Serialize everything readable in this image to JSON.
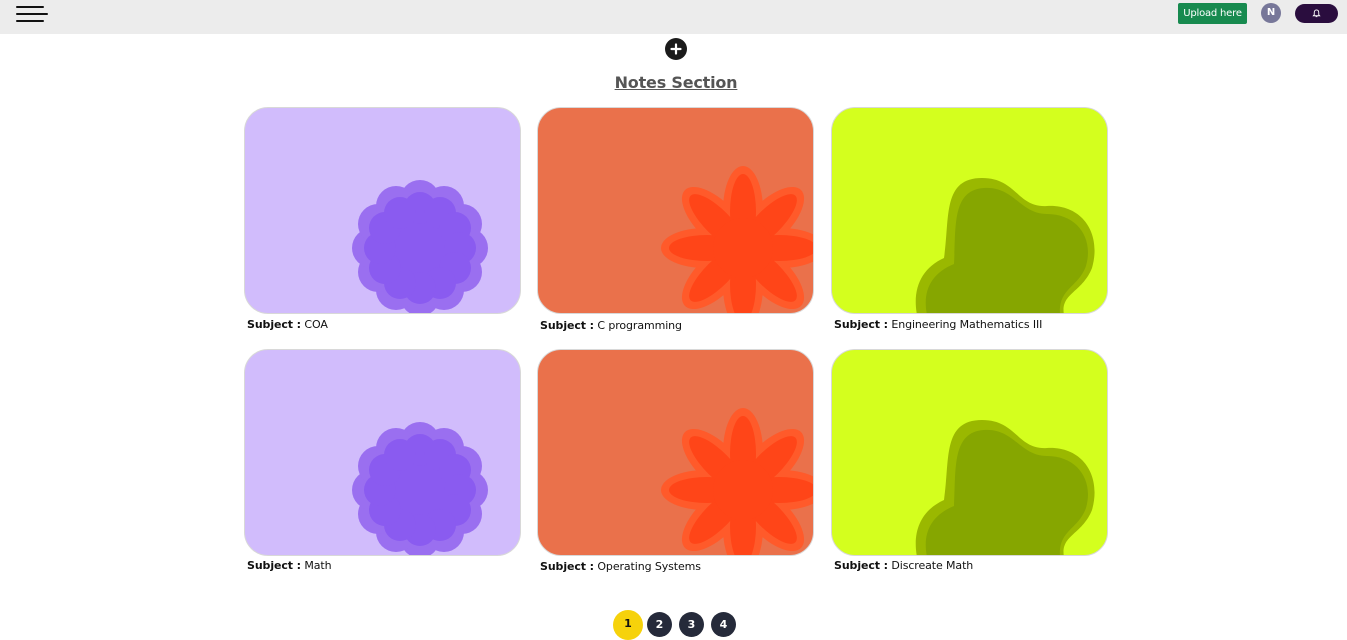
{
  "header": {
    "upload_label": "Upload here",
    "avatar_initial": "N",
    "menu_icon": "hamburger-menu-icon",
    "notif_icon": "bell-icon",
    "colors": {
      "bar": "#ececec",
      "upload": "#178a4f",
      "avatar": "#777799",
      "notif": "#2a0d3e"
    }
  },
  "main": {
    "add_icon": "plus-circle-icon",
    "title": "Notes Section",
    "subject_label": "Subject :",
    "cards": [
      {
        "subject": "COA",
        "theme": "purple-flower"
      },
      {
        "subject": "C programming",
        "theme": "orange-star"
      },
      {
        "subject": "Engineering Mathematics III",
        "theme": "green-blob"
      },
      {
        "subject": "Math",
        "theme": "purple-flower"
      },
      {
        "subject": "Operating Systems",
        "theme": "orange-star"
      },
      {
        "subject": "Discreate Math",
        "theme": "green-blob"
      }
    ]
  },
  "pagination": {
    "pages": [
      "1",
      "2",
      "3",
      "4"
    ],
    "current": "1",
    "colors": {
      "active": "#f6d20b",
      "inactive": "#252a3a"
    }
  }
}
